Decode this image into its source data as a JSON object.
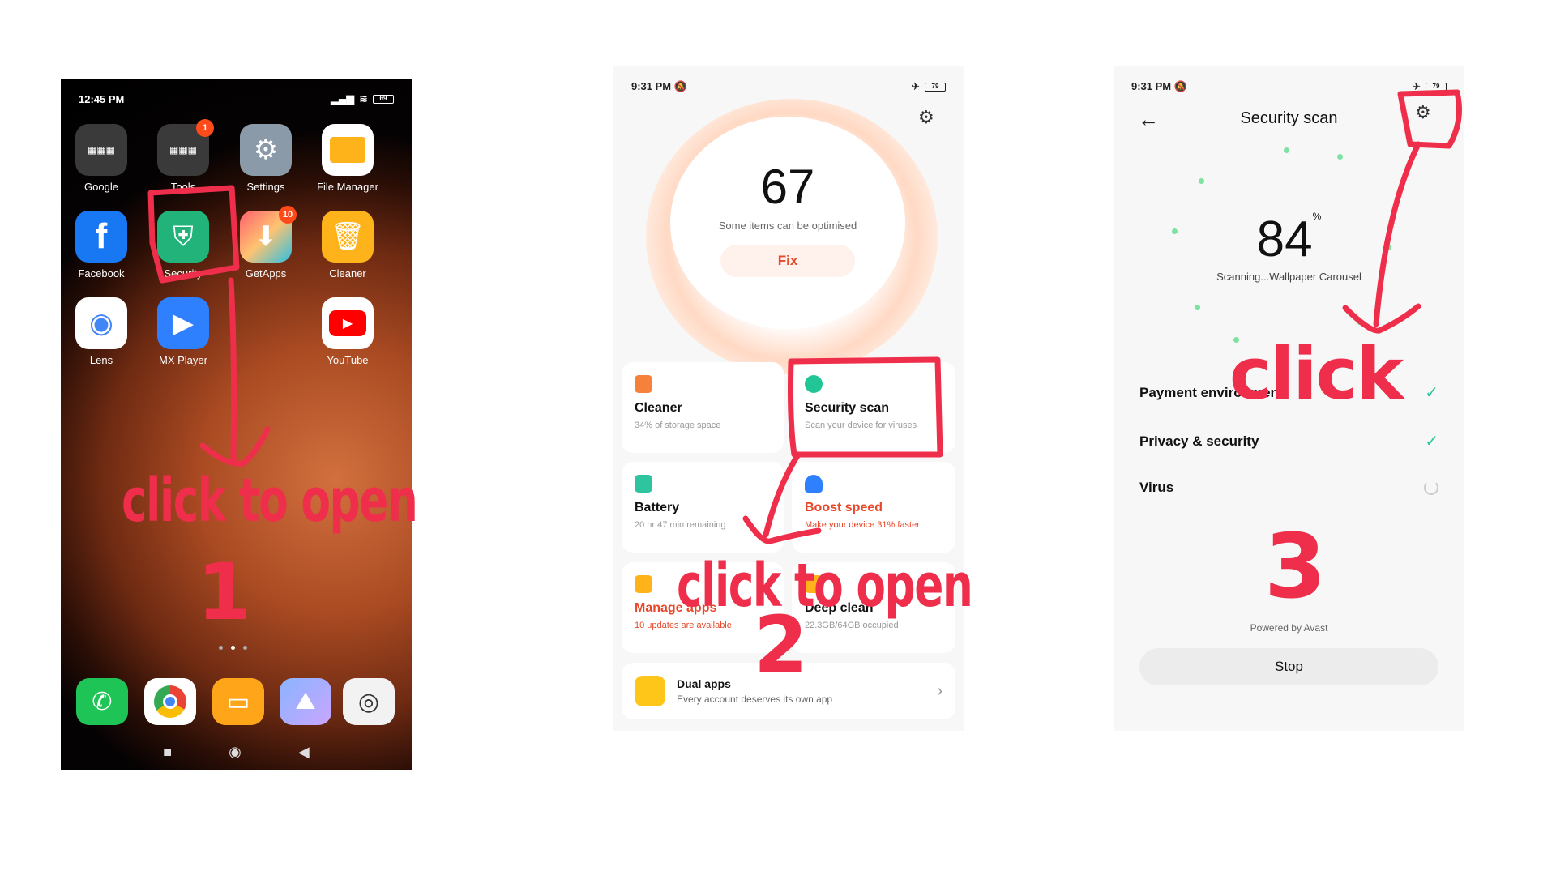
{
  "screen1": {
    "time": "12:45 PM",
    "status_icons": "G ☗ ▣ ···",
    "battery": "69",
    "apps": [
      {
        "label": "Google",
        "icon": "google-folder-icon",
        "badge": ""
      },
      {
        "label": "Tools",
        "icon": "tools-folder-icon",
        "badge": "1"
      },
      {
        "label": "Settings",
        "icon": "settings-gear-icon",
        "badge": ""
      },
      {
        "label": "File Manager",
        "icon": "folder-icon",
        "badge": ""
      },
      {
        "label": "Facebook",
        "icon": "facebook-icon",
        "badge": ""
      },
      {
        "label": "Security",
        "icon": "shield-bolt-icon",
        "badge": ""
      },
      {
        "label": "GetApps",
        "icon": "getapps-icon",
        "badge": "10"
      },
      {
        "label": "Cleaner",
        "icon": "trash-icon",
        "badge": ""
      },
      {
        "label": "Lens",
        "icon": "lens-icon",
        "badge": ""
      },
      {
        "label": "MX Player",
        "icon": "play-icon",
        "badge": ""
      },
      {
        "label": "YouTube",
        "icon": "youtube-icon",
        "badge": ""
      }
    ],
    "dock": [
      "phone-icon",
      "chrome-icon",
      "notes-icon",
      "gallery-icon",
      "camera-icon"
    ]
  },
  "screen2": {
    "time": "9:31 PM",
    "battery": "79",
    "score": "67",
    "score_subtitle": "Some items can be optimised",
    "fix_label": "Fix",
    "cards": [
      {
        "title": "Cleaner",
        "subtitle": "34% of storage space",
        "color": "#f5813a"
      },
      {
        "title": "Security scan",
        "subtitle": "Scan your device for viruses",
        "color": "#22c596"
      },
      {
        "title": "Battery",
        "subtitle": "20 hr 47 min  remaining",
        "color": "#2ec4a0"
      },
      {
        "title": "Boost speed",
        "subtitle": "Make your device 31% faster",
        "color": "#2f80ff"
      },
      {
        "title": "Manage apps",
        "subtitle": "10 updates are available",
        "color": "#ffb31a"
      },
      {
        "title": "Deep clean",
        "subtitle": "22.3GB/64GB occupied",
        "color": "#ffb31a"
      }
    ],
    "dual": {
      "title": "Dual apps",
      "subtitle": "Every account deserves its own app"
    }
  },
  "screen3": {
    "time": "9:31 PM",
    "battery": "79",
    "title": "Security scan",
    "score": "84",
    "percent": "%",
    "scanning": "Scanning...Wallpaper Carousel",
    "rows": [
      {
        "label": "Payment environment",
        "state": "✓"
      },
      {
        "label": "Privacy & security",
        "state": "✓"
      },
      {
        "label": "Virus",
        "state": ""
      }
    ],
    "powered": "Powered by Avast",
    "stop_label": "Stop"
  },
  "annotations": {
    "a1_text": "click to open",
    "a1_num": "1",
    "a2_text": "click to open",
    "a2_num": "2",
    "a3_text": "click",
    "a3_num": "3",
    "color": "#ee2e4a"
  }
}
